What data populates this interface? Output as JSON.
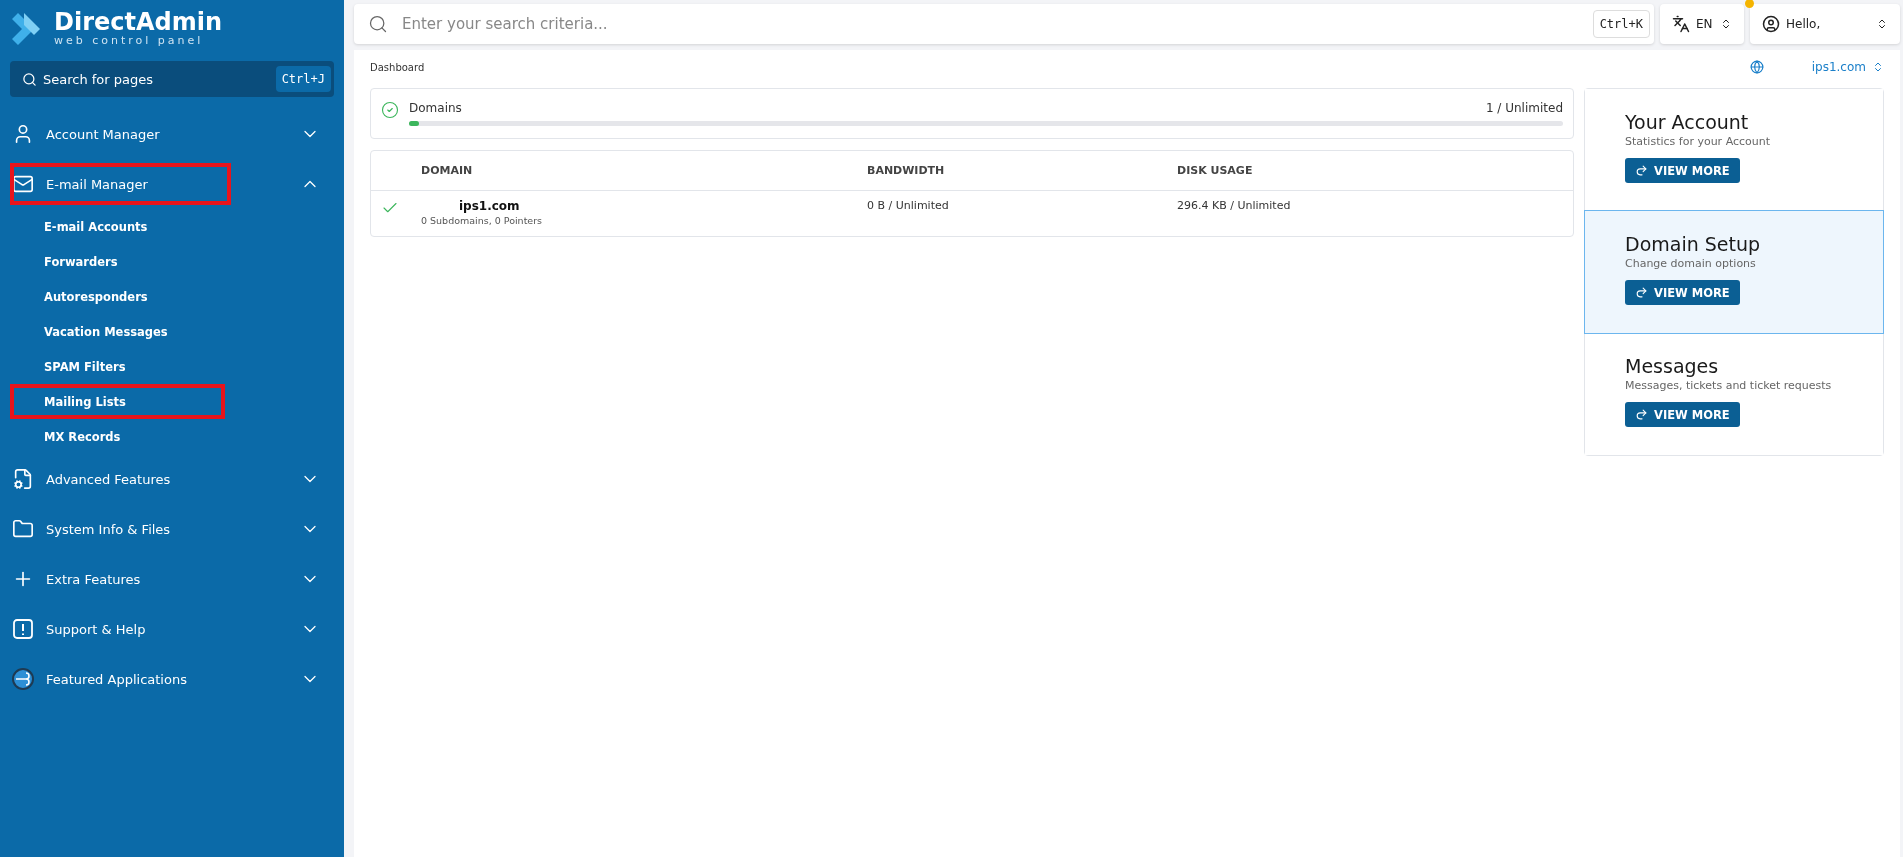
{
  "sidebar": {
    "logo_title": "DirectAdmin",
    "logo_subtitle": "web control panel",
    "search": {
      "placeholder": "Search for pages",
      "shortcut": "Ctrl+J"
    },
    "items": [
      {
        "kind": "account",
        "label": "Account Manager",
        "expanded": false,
        "highlighted": false
      },
      {
        "kind": "mail",
        "label": "E-mail Manager",
        "expanded": true,
        "highlighted": true,
        "children": [
          {
            "label": "E-mail Accounts",
            "highlighted": false
          },
          {
            "label": "Forwarders",
            "highlighted": false
          },
          {
            "label": "Autoresponders",
            "highlighted": false
          },
          {
            "label": "Vacation Messages",
            "highlighted": false
          },
          {
            "label": "SPAM Filters",
            "highlighted": false
          },
          {
            "label": "Mailing Lists",
            "highlighted": true
          },
          {
            "label": "MX Records",
            "highlighted": false
          }
        ]
      },
      {
        "kind": "advanced",
        "label": "Advanced Features",
        "expanded": false,
        "highlighted": false
      },
      {
        "kind": "system",
        "label": "System Info & Files",
        "expanded": false,
        "highlighted": false
      },
      {
        "kind": "extra",
        "label": "Extra Features",
        "expanded": false,
        "highlighted": false
      },
      {
        "kind": "support",
        "label": "Support & Help",
        "expanded": false,
        "highlighted": false
      },
      {
        "kind": "apps",
        "label": "Featured Applications",
        "expanded": false,
        "highlighted": false
      }
    ]
  },
  "topbar": {
    "search": {
      "placeholder": "Enter your search criteria...",
      "shortcut": "Ctrl+K"
    },
    "language": "EN",
    "notification": true,
    "user": "Hello,"
  },
  "breadcrumb": "Dashboard",
  "domain_selector": "ips1.com",
  "domains_usage": {
    "label": "Domains",
    "value": "1 / Unlimited",
    "level": 0.006
  },
  "table": {
    "columns": [
      "DOMAIN",
      "BANDWIDTH",
      "DISK USAGE"
    ],
    "rows": [
      {
        "active": true,
        "domain": "ips1.com",
        "details": "0 Subdomains, 0 Pointers",
        "bandwidth": "0 B / Unlimited",
        "disk_usage": "296.4 KB / Unlimited"
      }
    ]
  },
  "cards": [
    {
      "title": "Your Account",
      "subtitle": "Statistics for your Account",
      "button": "VIEW MORE",
      "selected": false
    },
    {
      "title": "Domain Setup",
      "subtitle": "Change domain options",
      "button": "VIEW MORE",
      "selected": true
    },
    {
      "title": "Messages",
      "subtitle": "Messages, tickets and ticket requests",
      "button": "VIEW MORE",
      "selected": false
    }
  ]
}
